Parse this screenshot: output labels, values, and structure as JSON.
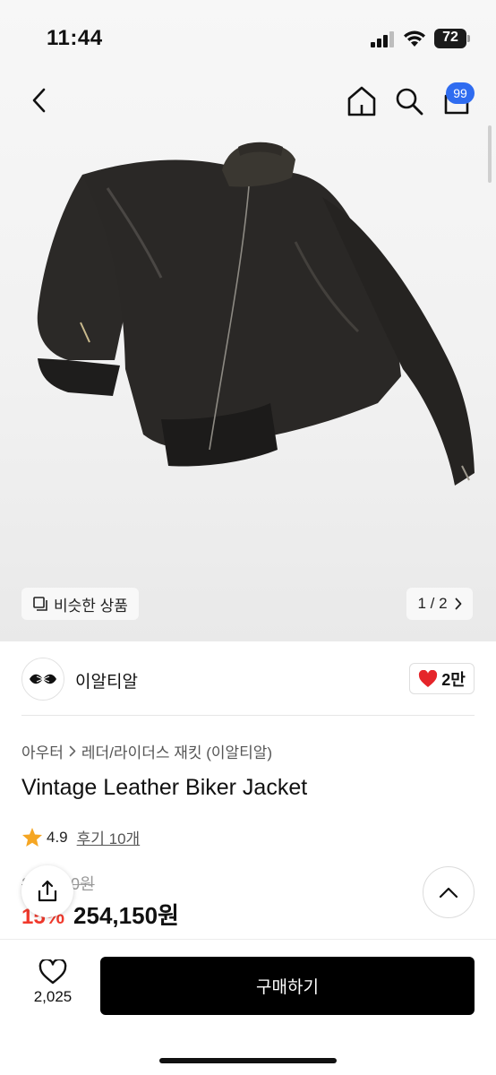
{
  "status_bar": {
    "time": "11:44",
    "battery": "72"
  },
  "header": {
    "cart_count": "99"
  },
  "gallery": {
    "similar_label": "비슷한 상품",
    "counter": "1 / 2"
  },
  "seller": {
    "name": "이알티알",
    "likes": "2만"
  },
  "breadcrumb": {
    "category": "아우터",
    "subcategory": "레더/라이더스 재킷 (이알티알)"
  },
  "product": {
    "title": "Vintage Leather Biker Jacket",
    "rating": "4.9",
    "reviews": "후기 10개",
    "original_price": "299,000원",
    "discount": "15%",
    "price": "254,150원"
  },
  "bottom_bar": {
    "wish_count": "2,025",
    "buy_label": "구매하기"
  },
  "colors": {
    "accent_blue": "#2f6cf0",
    "discount_red": "#f1392c",
    "heart_red": "#e5252a",
    "star_yellow": "#f5a623"
  }
}
